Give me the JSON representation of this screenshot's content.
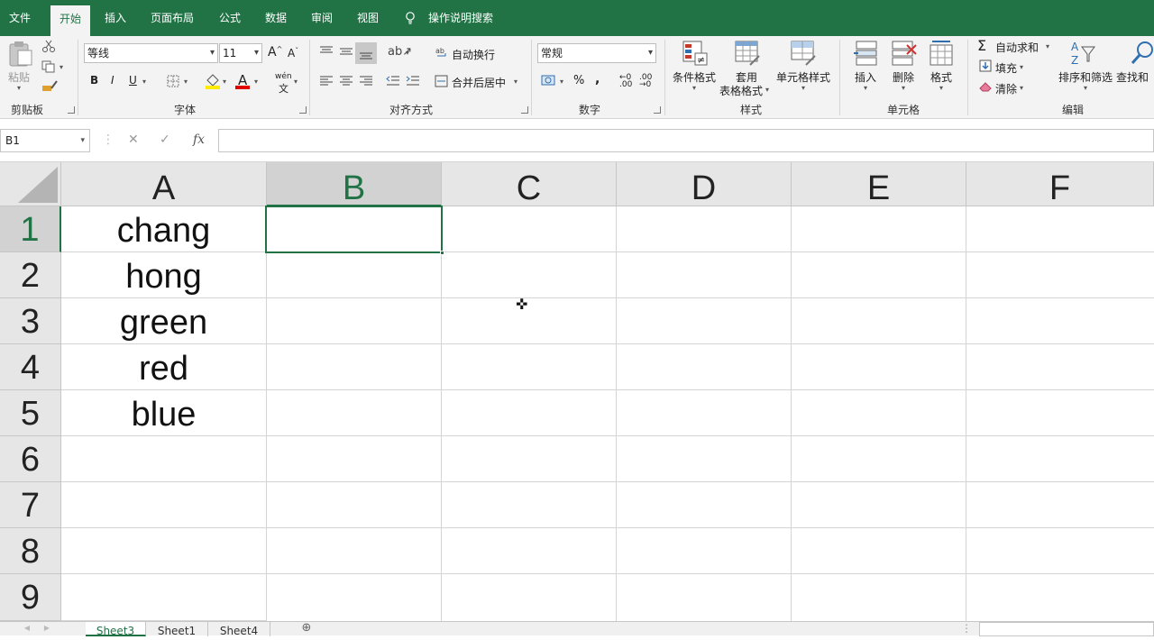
{
  "colors": {
    "accent": "#217346",
    "ribbon_bg": "#f3f3f3",
    "header_bg": "#e6e6e6"
  },
  "menu": {
    "tabs": [
      "文件",
      "开始",
      "插入",
      "页面布局",
      "公式",
      "数据",
      "审阅",
      "视图"
    ],
    "active_tab": "开始",
    "tell_me": "操作说明搜索"
  },
  "ribbon": {
    "clipboard": {
      "paste": "粘贴",
      "label": "剪贴板"
    },
    "font": {
      "font_name": "等线",
      "font_size": "11",
      "label": "字体",
      "bold": "B",
      "italic": "I",
      "underline": "U",
      "phonetic": "wén"
    },
    "alignment": {
      "wrap_text": "自动换行",
      "merge_center": "合并后居中",
      "label": "对齐方式"
    },
    "number": {
      "format": "常规",
      "percent": "%",
      "comma": ",",
      "label": "数字"
    },
    "styles": {
      "conditional": "条件格式",
      "table_format_1": "套用",
      "table_format_2": "表格格式",
      "cell_styles": "单元格样式",
      "label": "样式"
    },
    "cells": {
      "insert": "插入",
      "delete": "删除",
      "format": "格式",
      "label": "单元格"
    },
    "editing": {
      "autosum": "自动求和",
      "fill": "填充",
      "clear": "清除",
      "sort_filter": "排序和筛选",
      "find_select": "查找和",
      "label": "编辑"
    }
  },
  "formula_bar": {
    "name_box": "B1",
    "fx": "fx",
    "content": ""
  },
  "grid": {
    "columns": [
      "A",
      "B",
      "C",
      "D",
      "E",
      "F"
    ],
    "rows": [
      "1",
      "2",
      "3",
      "4",
      "5",
      "6",
      "7",
      "8",
      "9"
    ],
    "selected_cell": "B1",
    "column_a": [
      "chang",
      "hong",
      "green",
      "red",
      "blue",
      "",
      "",
      "",
      ""
    ]
  },
  "sheets": {
    "tabs": [
      "Sheet3",
      "Sheet1",
      "Sheet4"
    ],
    "active": "Sheet3"
  }
}
